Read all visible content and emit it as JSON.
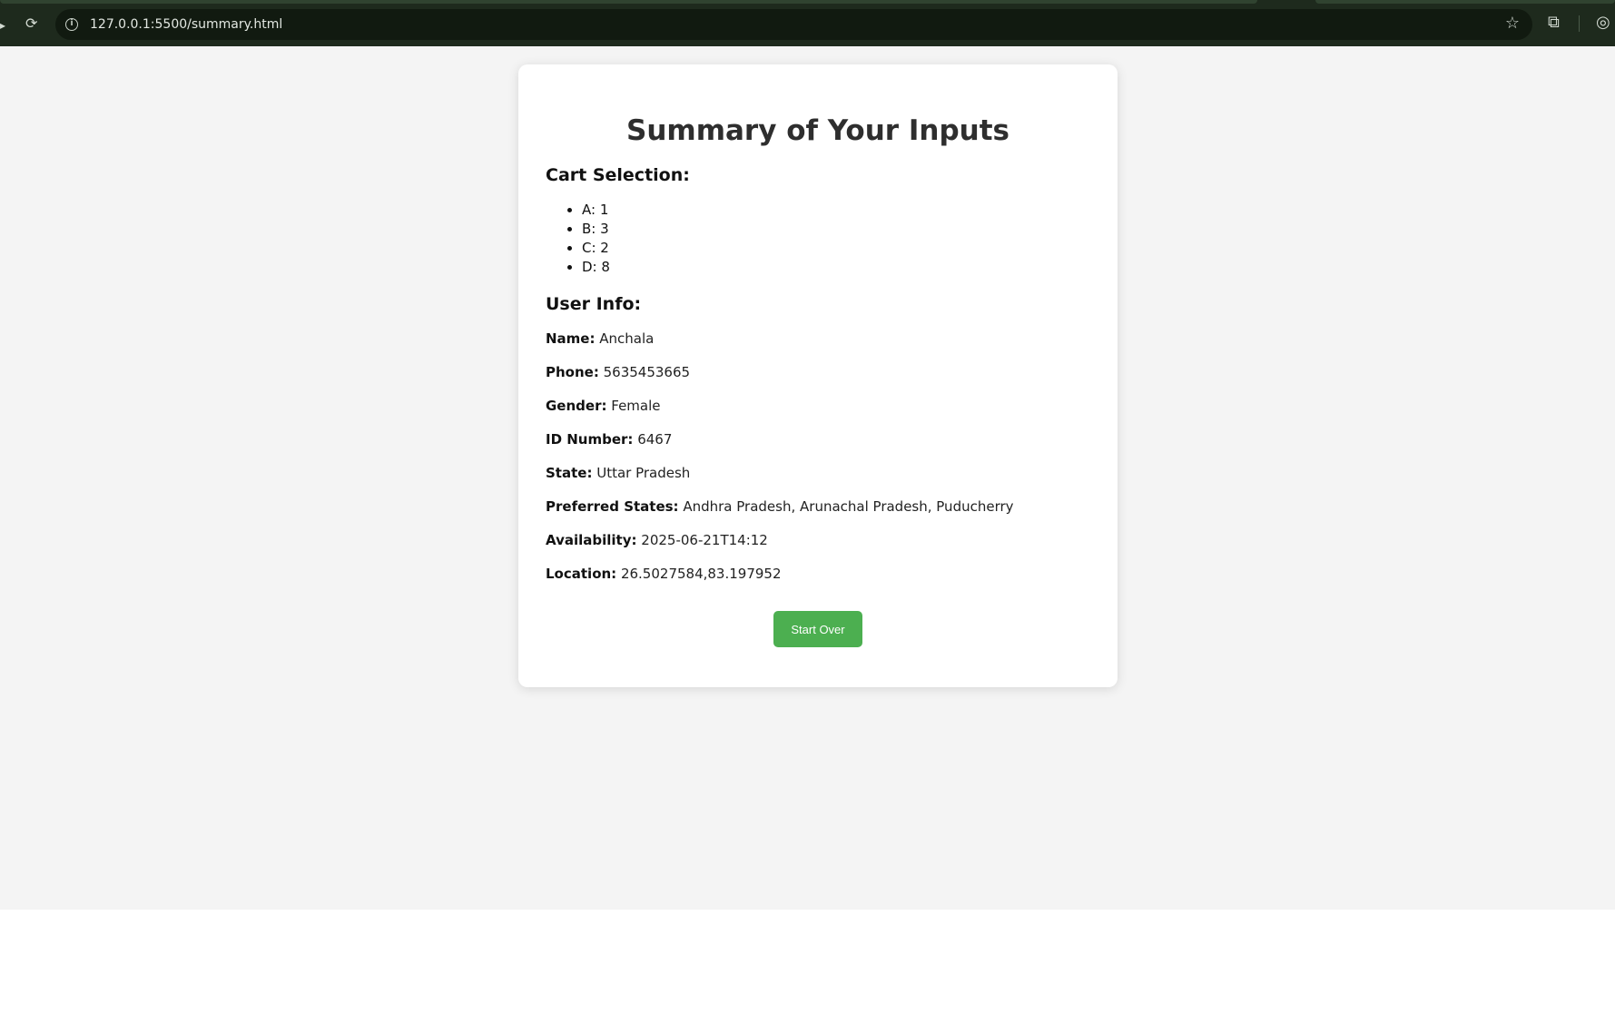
{
  "browser": {
    "url": "127.0.0.1:5500/summary.html",
    "reload_icon": "reload-icon",
    "info_icon": "info-icon",
    "bookmark_icon": "star-icon",
    "extensions_icon": "puzzle-icon",
    "chrome_color": "#1e2a1d"
  },
  "page": {
    "title": "Summary of Your Inputs",
    "background": "#f4f4f4"
  },
  "cart": {
    "heading": "Cart Selection:",
    "items": [
      "A: 1",
      "B: 3",
      "C: 2",
      "D: 8"
    ]
  },
  "user": {
    "heading": "User Info:",
    "fields": [
      {
        "label": "Name:",
        "value": "Anchala"
      },
      {
        "label": "Phone:",
        "value": "5635453665"
      },
      {
        "label": "Gender:",
        "value": "Female"
      },
      {
        "label": "ID Number:",
        "value": "6467"
      },
      {
        "label": "State:",
        "value": "Uttar Pradesh"
      },
      {
        "label": "Preferred States:",
        "value": "Andhra Pradesh, Arunachal Pradesh, Puducherry"
      },
      {
        "label": "Availability:",
        "value": "2025-06-21T14:12"
      },
      {
        "label": "Location:",
        "value": "26.5027584,83.197952"
      }
    ]
  },
  "actions": {
    "start_over_label": "Start Over",
    "button_color": "#4caf50"
  }
}
